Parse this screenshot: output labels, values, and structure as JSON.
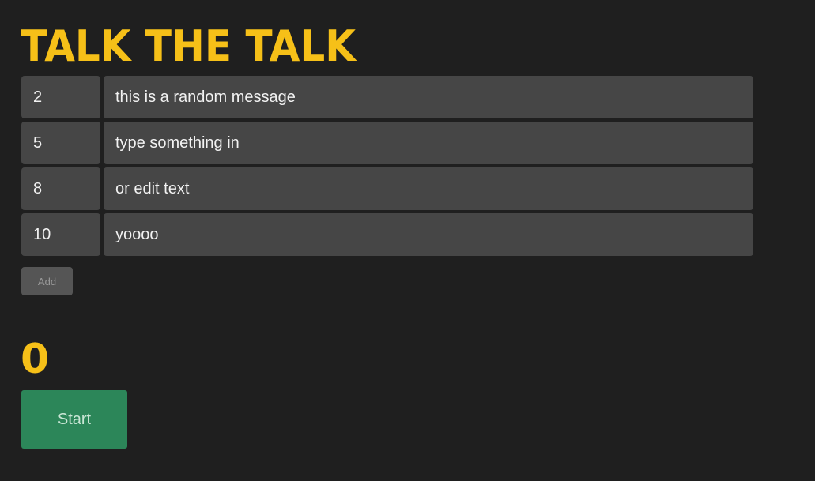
{
  "app": {
    "title": "TALK THE TALK"
  },
  "messages": [
    {
      "time": "2",
      "text": "this is a random message"
    },
    {
      "time": "5",
      "text": "type something in"
    },
    {
      "time": "8",
      "text": "or edit text"
    },
    {
      "time": "10",
      "text": "yoooo"
    }
  ],
  "controls": {
    "add_label": "Add",
    "start_label": "Start"
  },
  "counter": {
    "value": "0"
  },
  "colors": {
    "background": "#1f1f1f",
    "accent_yellow": "#f6c018",
    "field_bg": "#464646",
    "start_green": "#2c8659"
  }
}
